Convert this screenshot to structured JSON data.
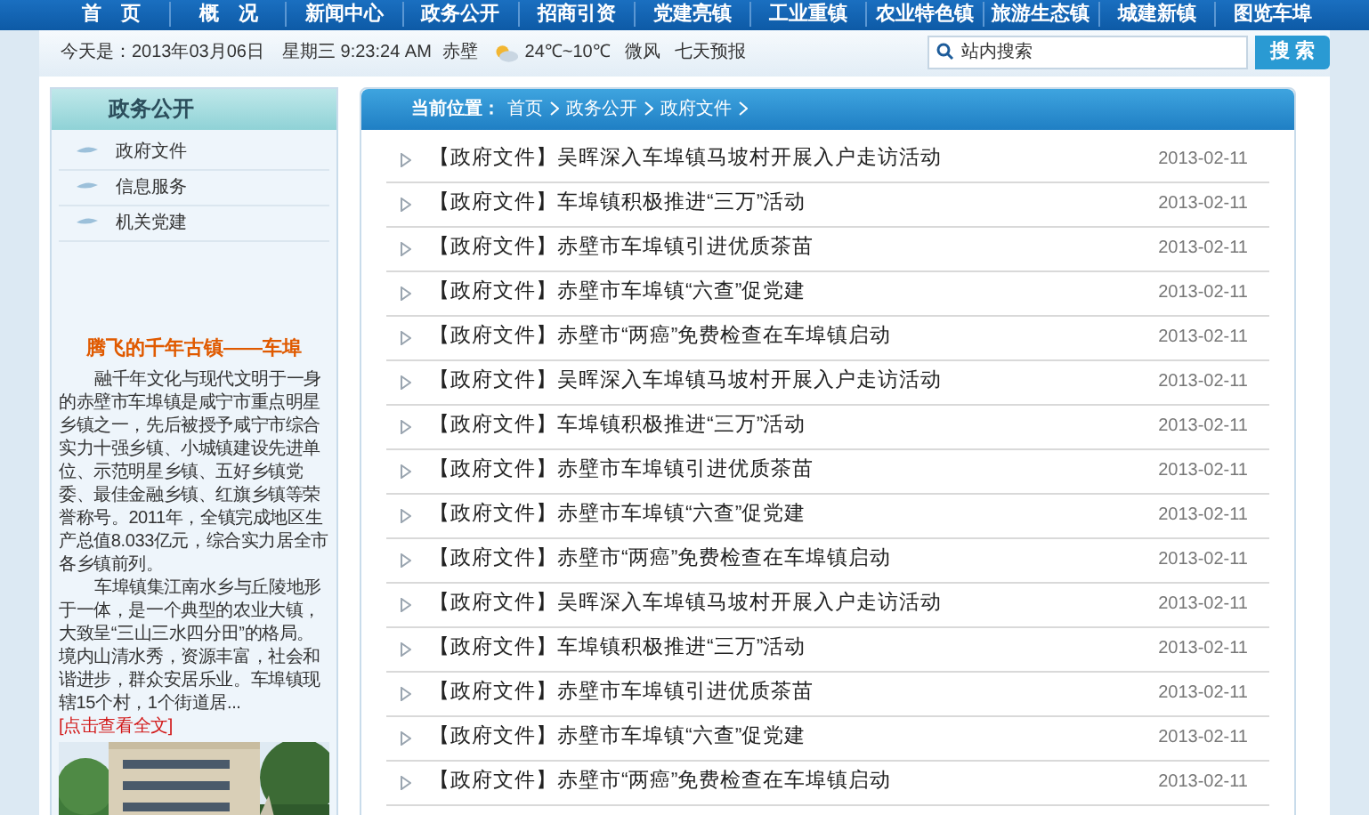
{
  "nav": [
    {
      "label": "首　页"
    },
    {
      "label": "概　况"
    },
    {
      "label": "新闻中心"
    },
    {
      "label": "政务公开"
    },
    {
      "label": "招商引资"
    },
    {
      "label": "党建亮镇"
    },
    {
      "label": "工业重镇"
    },
    {
      "label": "农业特色镇"
    },
    {
      "label": "旅游生态镇"
    },
    {
      "label": "城建新镇"
    },
    {
      "label": "图览车埠"
    }
  ],
  "info_bar": {
    "date": "今天是：2013年03月06日　星期三 9:23:24 AM",
    "city": "赤壁",
    "temperature": "24℃~10℃",
    "wind": "微风",
    "forecast_link": "七天预报",
    "search": {
      "placeholder": "站内搜索"
    },
    "search_button": "搜 索"
  },
  "sidebar": {
    "title": "政务公开",
    "items": [
      {
        "label": "政府文件"
      },
      {
        "label": "信息服务"
      },
      {
        "label": "机关党建"
      }
    ],
    "feature": {
      "title": "腾飞的千年古镇——车埠",
      "paragraphs": [
        "融千年文化与现代文明于一身的赤壁市车埠镇是咸宁市重点明星乡镇之一，先后被授予咸宁市综合实力十强乡镇、小城镇建设先进单位、示范明星乡镇、五好乡镇党委、最佳金融乡镇、红旗乡镇等荣誉称号。2011年，全镇完成地区生产总值8.033亿元，综合实力居全市各乡镇前列。",
        "车埠镇集江南水乡与丘陵地形于一体，是一个典型的农业大镇，大致呈“三山三水四分田”的格局。境内山清水秀，资源丰富，社会和谐进步，群众安居乐业。车埠镇现辖15个村，1个街道居..."
      ],
      "more_link": "[点击查看全文]",
      "image": {
        "kind": "picture"
      }
    }
  },
  "breadcrumb": {
    "label": "当前位置：",
    "items": [
      "首页",
      "政务公开",
      "政府文件"
    ]
  },
  "articles": [
    {
      "title": "【政府文件】吴晖深入车埠镇马坡村开展入户走访活动",
      "date": "2013-02-11"
    },
    {
      "title": "【政府文件】车埠镇积极推进“三万”活动",
      "date": "2013-02-11"
    },
    {
      "title": "【政府文件】赤壁市车埠镇引进优质茶苗",
      "date": "2013-02-11"
    },
    {
      "title": "【政府文件】赤壁市车埠镇“六查”促党建",
      "date": "2013-02-11"
    },
    {
      "title": "【政府文件】赤壁市“两癌”免费检查在车埠镇启动",
      "date": "2013-02-11"
    },
    {
      "title": "【政府文件】吴晖深入车埠镇马坡村开展入户走访活动",
      "date": "2013-02-11"
    },
    {
      "title": "【政府文件】车埠镇积极推进“三万”活动",
      "date": "2013-02-11"
    },
    {
      "title": "【政府文件】赤壁市车埠镇引进优质茶苗",
      "date": "2013-02-11"
    },
    {
      "title": "【政府文件】赤壁市车埠镇“六查”促党建",
      "date": "2013-02-11"
    },
    {
      "title": "【政府文件】赤壁市“两癌”免费检查在车埠镇启动",
      "date": "2013-02-11"
    },
    {
      "title": "【政府文件】吴晖深入车埠镇马坡村开展入户走访活动",
      "date": "2013-02-11"
    },
    {
      "title": "【政府文件】车埠镇积极推进“三万”活动",
      "date": "2013-02-11"
    },
    {
      "title": "【政府文件】赤壁市车埠镇引进优质茶苗",
      "date": "2013-02-11"
    },
    {
      "title": "【政府文件】赤壁市车埠镇“六查”促党建",
      "date": "2013-02-11"
    },
    {
      "title": "【政府文件】赤壁市“两癌”免费检查在车埠镇启动",
      "date": "2013-02-11"
    }
  ]
}
